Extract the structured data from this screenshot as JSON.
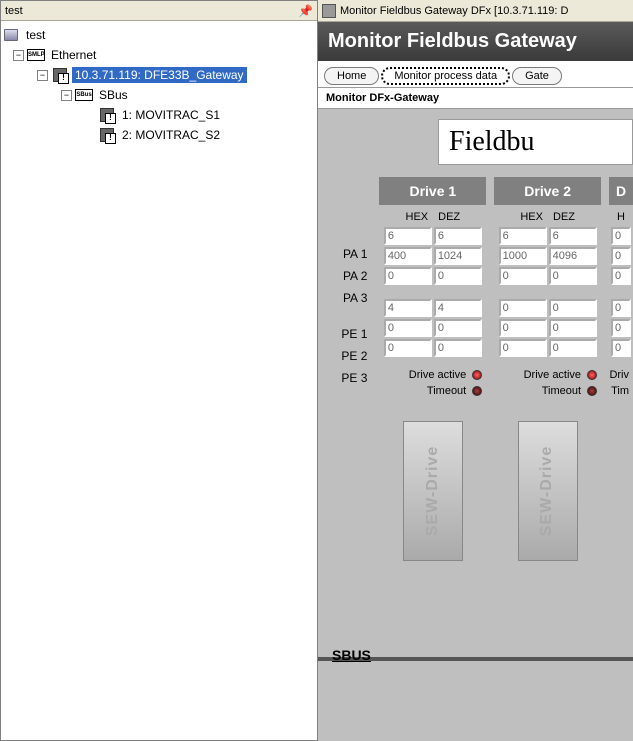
{
  "tree": {
    "header": "test",
    "root": "test",
    "eth": "Ethernet",
    "eth_icon": "SMLP",
    "gateway": "10.3.71.119: DFE33B_Gateway",
    "sbus": "SBus",
    "sbus_icon": "SBus",
    "dev1": "1: MOVITRAC_S1",
    "dev2": "2: MOVITRAC_S2"
  },
  "window_title": "Monitor Fieldbus Gateway DFx [10.3.71.119: D",
  "banner": "Monitor Fieldbus Gateway",
  "tabs": {
    "home": "Home",
    "monitor": "Monitor process data",
    "gate": "Gate"
  },
  "subhead": "Monitor DFx-Gateway",
  "fieldbus": "Fieldbu",
  "row_labels": {
    "pa1": "PA 1",
    "pa2": "PA 2",
    "pa3": "PA 3",
    "pe1": "PE 1",
    "pe2": "PE 2",
    "pe3": "PE 3"
  },
  "col_labels": {
    "hex": "HEX",
    "dez": "DEZ"
  },
  "drives": [
    {
      "name": "Drive 1",
      "pa": [
        [
          "6",
          "6"
        ],
        [
          "400",
          "1024"
        ],
        [
          "0",
          "0"
        ]
      ],
      "pe": [
        [
          "4",
          "4"
        ],
        [
          "0",
          "0"
        ],
        [
          "0",
          "0"
        ]
      ],
      "active": "Drive active",
      "timeout": "Timeout",
      "sew": "SEW-Drive"
    },
    {
      "name": "Drive 2",
      "pa": [
        [
          "6",
          "6"
        ],
        [
          "1000",
          "4096"
        ],
        [
          "0",
          "0"
        ]
      ],
      "pe": [
        [
          "0",
          "0"
        ],
        [
          "0",
          "0"
        ],
        [
          "0",
          "0"
        ]
      ],
      "active": "Drive active",
      "timeout": "Timeout",
      "sew": "SEW-Drive"
    },
    {
      "name": "D",
      "pa": [
        [
          "0",
          ""
        ],
        [
          "0",
          ""
        ],
        [
          "0",
          ""
        ]
      ],
      "pe": [
        [
          "0",
          ""
        ],
        [
          "0",
          ""
        ],
        [
          "0",
          ""
        ]
      ],
      "active": "Driv",
      "timeout": "Tim",
      "sew": ""
    }
  ],
  "col3_label": "H",
  "sbus_label": "SBUS"
}
